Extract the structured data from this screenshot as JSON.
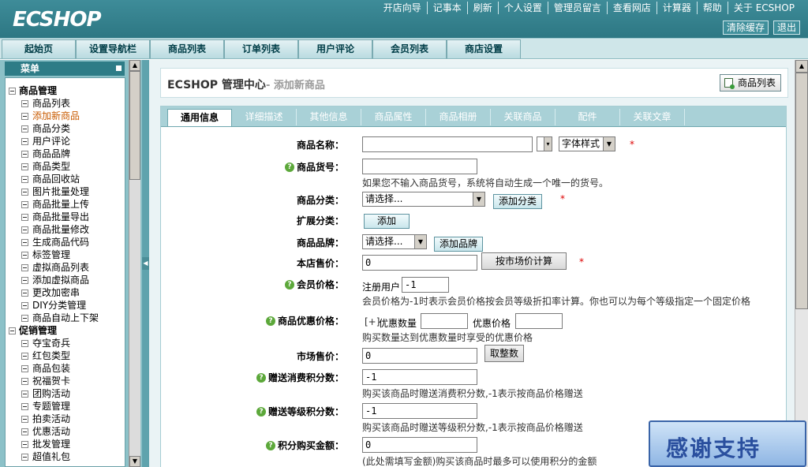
{
  "header": {
    "logo": "ECSHOP",
    "links": [
      "开店向导",
      "记事本",
      "刷新",
      "个人设置",
      "管理员留言",
      "查看网店",
      "计算器",
      "帮助",
      "关于 ECSHOP"
    ],
    "buttons": {
      "clear_cache": "清除缓存",
      "logout": "退出"
    }
  },
  "nav": {
    "tabs": [
      "起始页",
      "设置导航栏",
      "商品列表",
      "订单列表",
      "用户评论",
      "会员列表",
      "商店设置"
    ]
  },
  "sidebar": {
    "title": "菜单",
    "groups": [
      {
        "label": "商品管理",
        "items": [
          "商品列表",
          "添加新商品",
          "商品分类",
          "用户评论",
          "商品品牌",
          "商品类型",
          "商品回收站",
          "图片批量处理",
          "商品批量上传",
          "商品批量导出",
          "商品批量修改",
          "生成商品代码",
          "标签管理",
          "虚拟商品列表",
          "添加虚拟商品",
          "更改加密串",
          "DIY分类管理",
          "商品自动上下架"
        ]
      },
      {
        "label": "促销管理",
        "items": [
          "夺宝奇兵",
          "红包类型",
          "商品包装",
          "祝福贺卡",
          "团购活动",
          "专题管理",
          "拍卖活动",
          "优惠活动",
          "批发管理",
          "超值礼包"
        ]
      }
    ],
    "active_item": "添加新商品"
  },
  "page": {
    "title": "ECSHOP 管理中心",
    "subtitle": "- 添加新商品",
    "action_button": "商品列表"
  },
  "tabs": [
    "通用信息",
    "详细描述",
    "其他信息",
    "商品属性",
    "商品相册",
    "关联商品",
    "配件",
    "关联文章"
  ],
  "form": {
    "goods_name": {
      "label": "商品名称：",
      "value": "",
      "font_style": "字体样式",
      "required": "*"
    },
    "goods_sn": {
      "label": "商品货号：",
      "value": "",
      "note": "如果您不输入商品货号，系统将自动生成一个唯一的货号。"
    },
    "category": {
      "label": "商品分类：",
      "value": "请选择...",
      "button": "添加分类",
      "required": "*"
    },
    "ext_category": {
      "label": "扩展分类：",
      "button": "添加"
    },
    "brand": {
      "label": "商品品牌：",
      "value": "请选择...",
      "button": "添加品牌"
    },
    "shop_price": {
      "label": "本店售价：",
      "value": "0",
      "button": "按市场价计算",
      "required": "*"
    },
    "member_price": {
      "label": "会员价格：",
      "rank": "注册用户",
      "value": "-1",
      "note": "会员价格为-1时表示会员价格按会员等级折扣率计算。你也可以为每个等级指定一个固定价格"
    },
    "volume_price": {
      "label": "商品优惠价格：",
      "toggle": "[+]",
      "qty_label": "优惠数量",
      "qty": "",
      "price_label": "优惠价格",
      "price": "",
      "note": "购买数量达到优惠数量时享受的优惠价格"
    },
    "market_price": {
      "label": "市场售价：",
      "value": "0",
      "button": "取整数"
    },
    "give_integral": {
      "label": "赠送消费积分数：",
      "value": "-1",
      "note": "购买该商品时赠送消费积分数,-1表示按商品价格赠送"
    },
    "rank_integral": {
      "label": "赠送等级积分数：",
      "value": "-1",
      "note": "购买该商品时赠送等级积分数,-1表示按商品价格赠送"
    },
    "integral": {
      "label": "积分购买金额：",
      "value": "0",
      "note": "(此处需填写金额)购买该商品时最多可以使用积分的金额"
    }
  },
  "overlay": {
    "thanks": "感谢支持"
  }
}
